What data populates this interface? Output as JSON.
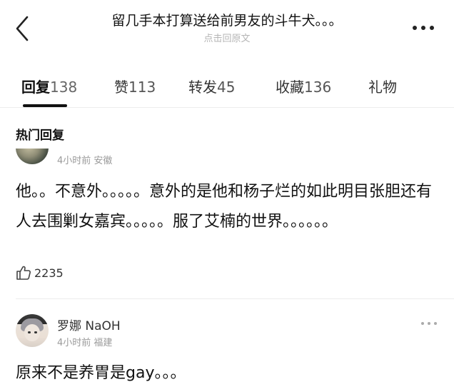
{
  "header": {
    "title": "留几手本打算送给前男友的斗牛犬。。。",
    "subtitle": "点击回原文"
  },
  "tabs": [
    {
      "label": "回复",
      "count": "138",
      "active": true
    },
    {
      "label": "赞",
      "count": "113"
    },
    {
      "label": "转发",
      "count": "45"
    },
    {
      "label": "收藏",
      "count": "136"
    },
    {
      "label": "礼物",
      "count": ""
    }
  ],
  "section_title": "热门回复",
  "comments": [
    {
      "meta": "4小时前 安徽",
      "text": "他。。不意外。。。。。意外的是他和杨子烂的如此明目张胆还有人去围剿女嘉宾。。。。。服了艾楠的世界。。。。。。",
      "likes": "2235"
    },
    {
      "username": "罗娜 NaOH",
      "meta": "4小时前 福建",
      "text": "原来不是养胃是gay。。。"
    }
  ]
}
